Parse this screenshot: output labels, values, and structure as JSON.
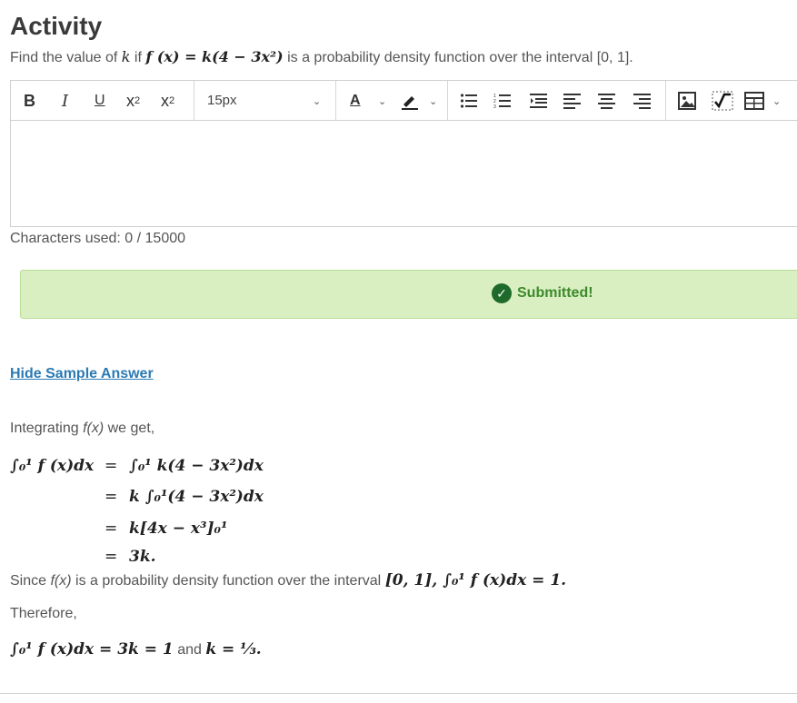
{
  "page": {
    "title": "Activity",
    "question_prefix": "Find the value of",
    "question_k": "k",
    "question_if": "if",
    "question_formula": "f (x) = k(4 − 3x²)",
    "question_suffix": "is a probability density function over the interval [0, 1]."
  },
  "editor": {
    "font_size_value": "15px",
    "toolbar_icons": [
      "bold-icon",
      "italic-icon",
      "underline-icon",
      "superscript-icon",
      "subscript-icon",
      "font-color-icon",
      "highlight-icon",
      "bullet-list-icon",
      "numbered-list-icon",
      "indent-icon",
      "align-left-icon",
      "align-center-icon",
      "align-right-icon",
      "image-icon",
      "math-icon",
      "table-icon"
    ],
    "counter_label": "Characters used: 0 / 15000"
  },
  "status": {
    "message": "Submitted!",
    "color": "#3d8a2c",
    "background": "#d9efc2"
  },
  "sample": {
    "toggle_label": "Hide Sample Answer",
    "intro_before": "Integrating",
    "intro_fx": "f(x)",
    "intro_after": "we get,",
    "line1_lhs": "∫₀¹ f (x)dx",
    "line1_rhs": "∫₀¹ k(4 − 3x²)dx",
    "line2_rhs": "k ∫₀¹(4 − 3x²)dx",
    "line3_rhs": "k[4x − x³]₀¹",
    "line4_rhs": "3k.",
    "since_before": "Since",
    "since_fx": "f(x)",
    "since_mid": "is a probability density function over the interval",
    "since_math": "[0, 1], ∫₀¹ f (x)dx = 1.",
    "therefore": "Therefore,",
    "final_math": "∫₀¹ f (x)dx = 3k = 1",
    "final_and": "and",
    "final_k": "k = ⅓."
  }
}
